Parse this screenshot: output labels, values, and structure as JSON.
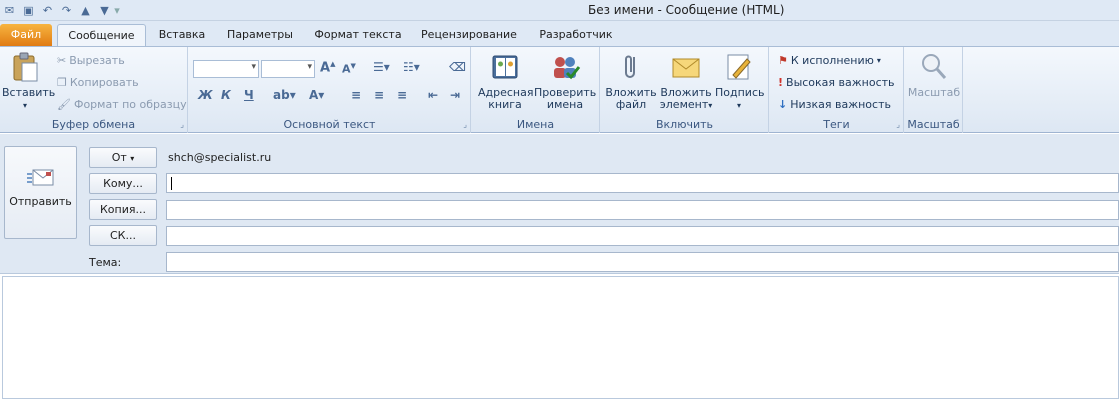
{
  "window": {
    "title": "Без имени  -  Сообщение (HTML)"
  },
  "qat": {
    "save_icon": "save-icon",
    "undo_icon": "undo-icon",
    "redo_icon": "redo-icon",
    "up_icon": "arrow-up-icon",
    "down_icon": "arrow-down-icon"
  },
  "tabs": [
    {
      "label": "Файл"
    },
    {
      "label": "Сообщение"
    },
    {
      "label": "Вставка"
    },
    {
      "label": "Параметры"
    },
    {
      "label": "Формат текста"
    },
    {
      "label": "Рецензирование"
    },
    {
      "label": "Разработчик"
    }
  ],
  "ribbon": {
    "clipboard": {
      "label": "Буфер обмена",
      "paste": "Вставить",
      "cut": "Вырезать",
      "copy": "Копировать",
      "format_painter": "Формат по образцу"
    },
    "basic_text": {
      "label": "Основной текст",
      "bold": "Ж",
      "italic": "К",
      "underline": "Ч"
    },
    "names": {
      "label": "Имена",
      "address_book": [
        "Адресная",
        "книга"
      ],
      "check_names": [
        "Проверить",
        "имена"
      ]
    },
    "include": {
      "label": "Включить",
      "attach_file": [
        "Вложить",
        "файл"
      ],
      "attach_item": [
        "Вложить",
        "элемент"
      ],
      "signature": "Подпись"
    },
    "tags": {
      "label": "Теги",
      "follow_up": "К исполнению",
      "high_importance": "Высокая важность",
      "low_importance": "Низкая важность"
    },
    "zoom": {
      "label": "Масштаб",
      "button": "Масштаб"
    }
  },
  "form": {
    "send": "Отправить",
    "from_button": "От",
    "from_value": "shch@specialist.ru",
    "to_button": "Кому...",
    "cc_button": "Копия...",
    "bcc_button": "СК...",
    "subject_label": "Тема:",
    "to_value": "",
    "cc_value": "",
    "bcc_value": "",
    "subject_value": ""
  }
}
